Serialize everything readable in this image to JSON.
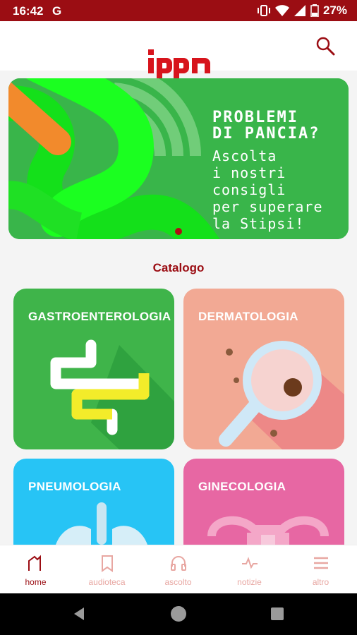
{
  "status_bar": {
    "time": "16:42",
    "carrier": "G",
    "battery": "27%"
  },
  "app": {
    "logo_text": "ippa"
  },
  "banner": {
    "headline_line1": "PROBLEMI",
    "headline_line2": "DI PANCIA?",
    "body_lines": [
      "Ascolta",
      "i nostri consigli",
      "per superare",
      "la Stipsi!"
    ]
  },
  "catalog": {
    "title": "Catalogo",
    "cards": [
      {
        "label": "GASTROENTEROLOGIA",
        "color": "#3fb44a"
      },
      {
        "label": "DERMATOLOGIA",
        "color": "#f2a994"
      },
      {
        "label": "PNEUMOLOGIA",
        "color": "#27c4f5"
      },
      {
        "label": "GINECOLOGIA",
        "color": "#e767a3"
      }
    ]
  },
  "bottom_nav": {
    "items": [
      {
        "label": "home",
        "icon": "home-icon",
        "active": true
      },
      {
        "label": "audioteca",
        "icon": "bookmark-icon"
      },
      {
        "label": "ascolto",
        "icon": "headphones-icon"
      },
      {
        "label": "notizie",
        "icon": "news-icon"
      },
      {
        "label": "altro",
        "icon": "menu-icon"
      }
    ]
  },
  "colors": {
    "brand": "#9b0d13",
    "accent": "#b00f14",
    "nav_inactive": "#e8a7a2"
  }
}
